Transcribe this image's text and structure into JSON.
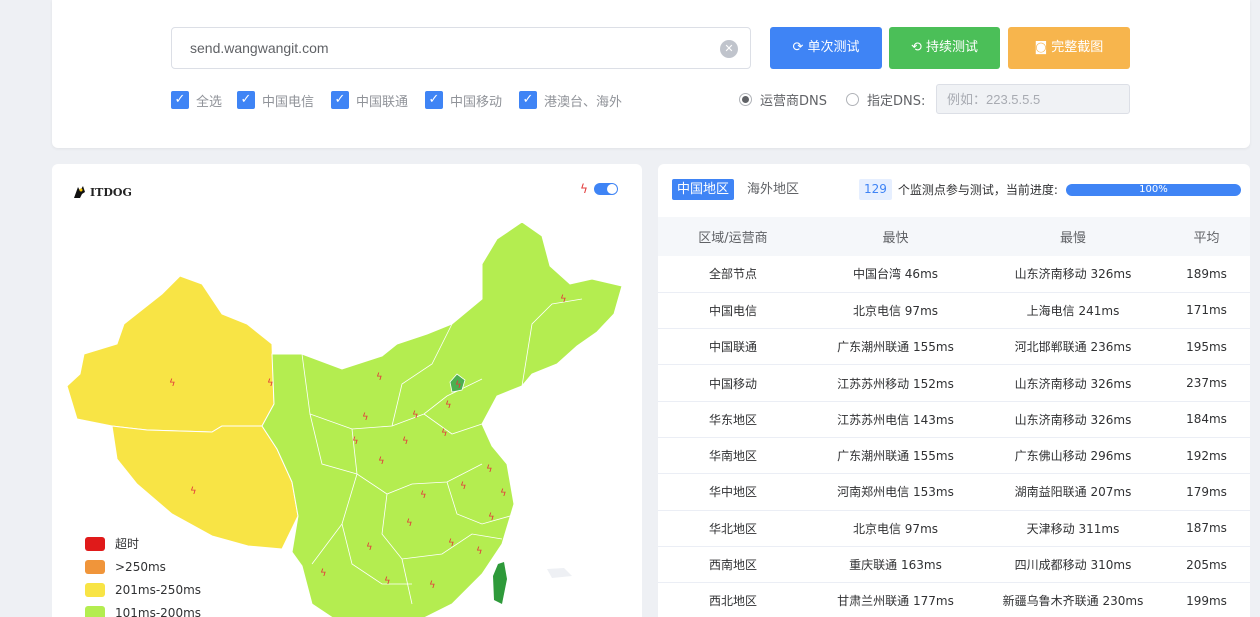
{
  "search": {
    "url_value": "send.wangwangit.com",
    "clear_icon": "close-circle-icon"
  },
  "buttons": {
    "single_test": "单次测试",
    "continuous_test": "持续测试",
    "full_screenshot": "完整截图"
  },
  "isp_filters": [
    {
      "label": "全选",
      "checked": true
    },
    {
      "label": "中国电信",
      "checked": true
    },
    {
      "label": "中国联通",
      "checked": true
    },
    {
      "label": "中国移动",
      "checked": true
    },
    {
      "label": "港澳台、海外",
      "checked": true
    }
  ],
  "dns": {
    "isp_dns_label": "运营商DNS",
    "custom_dns_label": "指定DNS:",
    "custom_dns_placeholder": "例如：223.5.5.5",
    "selected": "isp"
  },
  "map": {
    "logo_text": "ITDOG",
    "legend": [
      {
        "label": "超时",
        "color": "#e01a1a"
      },
      {
        "label": ">250ms",
        "color": "#f0953a"
      },
      {
        "label": "201ms-250ms",
        "color": "#f8e445"
      },
      {
        "label": "101ms-200ms",
        "color": "#b4ed50"
      }
    ],
    "region_colors": {
      "yellow": "#f8e445",
      "green": "#b4ed50",
      "dark_green": "#4caf50",
      "taiwan": "#2e9a3a"
    }
  },
  "table": {
    "tabs": [
      {
        "label": "中国地区",
        "active": true
      },
      {
        "label": "海外地区",
        "active": false
      }
    ],
    "node_count": "129",
    "progress_text": "个监测点参与测试，当前进度:",
    "progress_percent": "100%",
    "headers": [
      "区域/运营商",
      "最快",
      "最慢",
      "平均"
    ],
    "rows": [
      [
        "全部节点",
        "中国台湾 46ms",
        "山东济南移动 326ms",
        "189ms"
      ],
      [
        "中国电信",
        "北京电信 97ms",
        "上海电信 241ms",
        "171ms"
      ],
      [
        "中国联通",
        "广东潮州联通 155ms",
        "河北邯郸联通 236ms",
        "195ms"
      ],
      [
        "中国移动",
        "江苏苏州移动 152ms",
        "山东济南移动 326ms",
        "237ms"
      ],
      [
        "华东地区",
        "江苏苏州电信 143ms",
        "山东济南移动 326ms",
        "184ms"
      ],
      [
        "华南地区",
        "广东潮州联通 155ms",
        "广东佛山移动 296ms",
        "192ms"
      ],
      [
        "华中地区",
        "河南郑州电信 153ms",
        "湖南益阳联通 207ms",
        "179ms"
      ],
      [
        "华北地区",
        "北京电信 97ms",
        "天津移动 311ms",
        "187ms"
      ],
      [
        "西南地区",
        "重庆联通 163ms",
        "四川成都移动 310ms",
        "205ms"
      ],
      [
        "西北地区",
        "甘肃兰州联通 177ms",
        "新疆乌鲁木齐联通 230ms",
        "199ms"
      ]
    ]
  }
}
